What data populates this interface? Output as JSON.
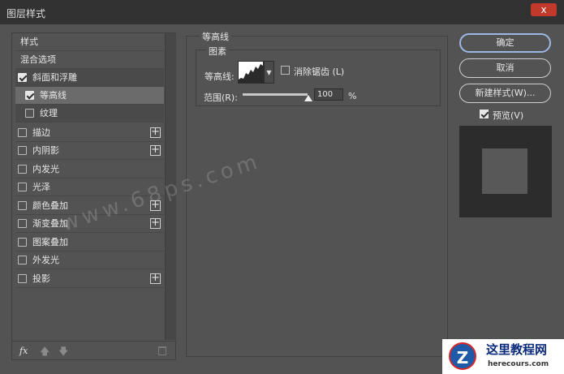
{
  "window": {
    "title": "图层样式",
    "close_glyph": "x"
  },
  "left_list": {
    "header": "样式",
    "items": [
      {
        "label": "混合选项",
        "checkbox": false,
        "checked": false,
        "plus": false
      },
      {
        "label": "斜面和浮雕",
        "checkbox": true,
        "checked": true,
        "plus": false
      },
      {
        "label": "等高线",
        "checkbox": true,
        "checked": true,
        "plus": false,
        "sub": true,
        "selected": true
      },
      {
        "label": "纹理",
        "checkbox": true,
        "checked": false,
        "plus": false,
        "sub": true
      },
      {
        "label": "描边",
        "checkbox": true,
        "checked": false,
        "plus": true
      },
      {
        "label": "内阴影",
        "checkbox": true,
        "checked": false,
        "plus": true
      },
      {
        "label": "内发光",
        "checkbox": true,
        "checked": false,
        "plus": false
      },
      {
        "label": "光泽",
        "checkbox": true,
        "checked": false,
        "plus": false
      },
      {
        "label": "颜色叠加",
        "checkbox": true,
        "checked": false,
        "plus": true
      },
      {
        "label": "渐变叠加",
        "checkbox": true,
        "checked": false,
        "plus": true
      },
      {
        "label": "图案叠加",
        "checkbox": true,
        "checked": false,
        "plus": false
      },
      {
        "label": "外发光",
        "checkbox": true,
        "checked": false,
        "plus": false
      },
      {
        "label": "投影",
        "checkbox": true,
        "checked": false,
        "plus": true
      }
    ],
    "fx_label": "fx",
    "icons": [
      "fx-icon",
      "move-up-icon",
      "move-down-icon",
      "trash-icon"
    ]
  },
  "contour_panel": {
    "section_title": "等高线",
    "group_title": "图素",
    "contour_label": "等高线:",
    "anti_alias_label": "消除锯齿 (L)",
    "anti_alias_checked": false,
    "range_label": "范围(R):",
    "range_value": "100",
    "range_percent": 100,
    "range_unit": "%"
  },
  "actions": {
    "ok": "确定",
    "cancel": "取消",
    "new_style": "新建样式(W)...",
    "preview_label": "预览(V)",
    "preview_checked": true
  },
  "watermark": {
    "text": "www.68ps.com",
    "logo_title": "这里教程网",
    "logo_sub": "herecours.com",
    "logo_glyph": "Z"
  },
  "colors": {
    "dialog_bg": "#535353",
    "titlebar_bg": "#323232",
    "close_red": "#c0392b",
    "primary_border": "#9bb7e4",
    "selected_item": "#6b6b6b"
  }
}
